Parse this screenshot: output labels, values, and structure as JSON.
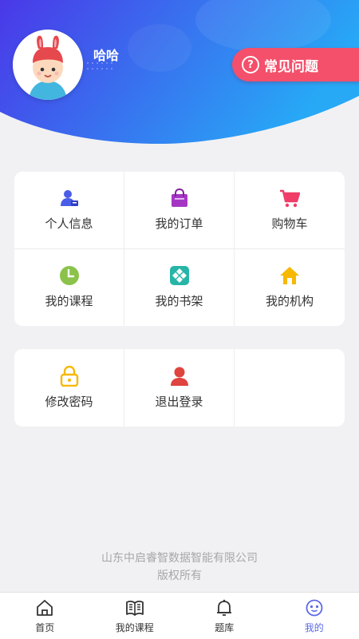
{
  "profile": {
    "username": "哈哈"
  },
  "faq": {
    "label": "常见问题"
  },
  "menu_main": [
    {
      "label": "个人信息",
      "icon": "user-card-icon"
    },
    {
      "label": "我的订单",
      "icon": "shopping-bag-icon"
    },
    {
      "label": "购物车",
      "icon": "cart-icon"
    },
    {
      "label": "我的课程",
      "icon": "clock-icon"
    },
    {
      "label": "我的书架",
      "icon": "bookshelf-icon"
    },
    {
      "label": "我的机构",
      "icon": "house-icon"
    }
  ],
  "menu_account": [
    {
      "label": "修改密码",
      "icon": "lock-icon"
    },
    {
      "label": "退出登录",
      "icon": "logout-person-icon"
    }
  ],
  "footer": {
    "company": "山东中启睿智数据智能有限公司",
    "rights": "版权所有"
  },
  "tabbar": [
    {
      "label": "首页",
      "icon": "home-icon"
    },
    {
      "label": "我的课程",
      "icon": "book-icon"
    },
    {
      "label": "题库",
      "icon": "bell-icon"
    },
    {
      "label": "我的",
      "icon": "smiley-icon",
      "active": true
    }
  ],
  "colors": {
    "header_gradient_start": "#4a38e8",
    "header_gradient_end": "#27a9f6",
    "faq_bg": "#f4506b",
    "active_tab": "#5c69e6",
    "footer_text": "#a7a7a7"
  }
}
